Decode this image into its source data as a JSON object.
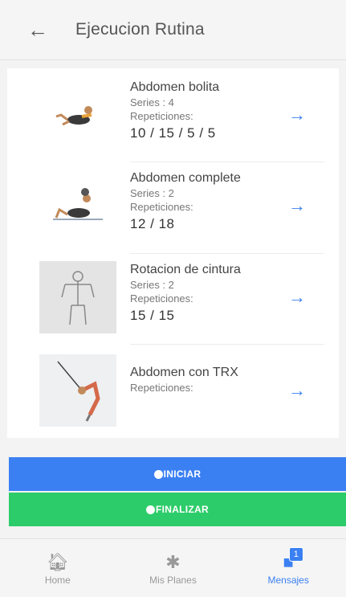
{
  "header": {
    "title": "Ejecucion Rutina",
    "back_icon": "arrow-left-icon"
  },
  "exercises": [
    {
      "name": "Abdomen bolita",
      "series": "Series : 4",
      "reps_label": "Repeticiones:",
      "reps": "10 / 15 / 5 / 5"
    },
    {
      "name": "Abdomen complete",
      "series": "Series : 2",
      "reps_label": "Repeticiones:",
      "reps": "12 / 18"
    },
    {
      "name": "Rotacion de cintura",
      "series": "Series : 2",
      "reps_label": "Repeticiones:",
      "reps": "15 / 15"
    },
    {
      "name": "Abdomen con TRX",
      "series": "",
      "reps_label": "Repeticiones:",
      "reps": ""
    }
  ],
  "actions": {
    "start_label": "INICIAR",
    "end_label": "FINALIZAR"
  },
  "tabbar": {
    "home_label": "Home",
    "plans_label": "Mis Planes",
    "messages_label": "Mensajes",
    "messages_badge": "1"
  },
  "colors": {
    "accent": "#3b80f2",
    "finish": "#2dcc6a"
  }
}
